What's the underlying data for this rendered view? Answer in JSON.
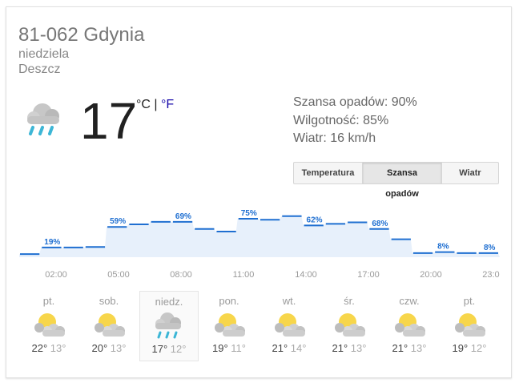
{
  "location": "81-062 Gdynia",
  "day": "niedziela",
  "condition": "Deszcz",
  "current": {
    "temperature": "17",
    "unit_c": "°C",
    "separator": "|",
    "unit_f": "°F",
    "icon": "rain-cloud-icon"
  },
  "stats": {
    "precip": "Szansa opadów: 90%",
    "humidity": "Wilgotność: 85%",
    "wind": "Wiatr: 16 km/h"
  },
  "tabs": [
    {
      "label": "Temperatura",
      "active": false
    },
    {
      "label": "Szansa opadów",
      "active": true
    },
    {
      "label": "Wiatr",
      "active": false
    }
  ],
  "chart_data": {
    "type": "area",
    "x": [
      "00:00",
      "01:00",
      "02:00",
      "03:00",
      "04:00",
      "05:00",
      "06:00",
      "07:00",
      "08:00",
      "09:00",
      "10:00",
      "11:00",
      "12:00",
      "13:00",
      "14:00",
      "15:00",
      "16:00",
      "17:00",
      "18:00",
      "19:00",
      "20:00",
      "21:00",
      "22:00",
      "23:00"
    ],
    "values": [
      6,
      19,
      19,
      20,
      59,
      64,
      69,
      69,
      55,
      50,
      75,
      73,
      80,
      62,
      65,
      68,
      55,
      35,
      8,
      10,
      8,
      8
    ],
    "tick_labels": [
      "02:00",
      "05:00",
      "08:00",
      "11:00",
      "14:00",
      "17:00",
      "20:00",
      "23:00"
    ],
    "data_labels": [
      "19%",
      "59%",
      "69%",
      "75%",
      "62%",
      "68%",
      "8%",
      "8%"
    ],
    "color": "#1f6fd1",
    "fill": "#e7f0fb"
  },
  "forecast": [
    {
      "day": "pt.",
      "hi": "22°",
      "lo": "13°",
      "icon": "partly-sunny-icon"
    },
    {
      "day": "sob.",
      "hi": "20°",
      "lo": "13°",
      "icon": "partly-sunny-icon"
    },
    {
      "day": "niedz.",
      "hi": "17°",
      "lo": "12°",
      "icon": "rain-cloud-icon"
    },
    {
      "day": "pon.",
      "hi": "19°",
      "lo": "11°",
      "icon": "partly-sunny-icon"
    },
    {
      "day": "wt.",
      "hi": "21°",
      "lo": "14°",
      "icon": "partly-sunny-icon"
    },
    {
      "day": "śr.",
      "hi": "21°",
      "lo": "13°",
      "icon": "partly-sunny-icon"
    },
    {
      "day": "czw.",
      "hi": "21°",
      "lo": "13°",
      "icon": "partly-sunny-icon"
    },
    {
      "day": "pt.",
      "hi": "19°",
      "lo": "12°",
      "icon": "partly-sunny-icon"
    }
  ]
}
